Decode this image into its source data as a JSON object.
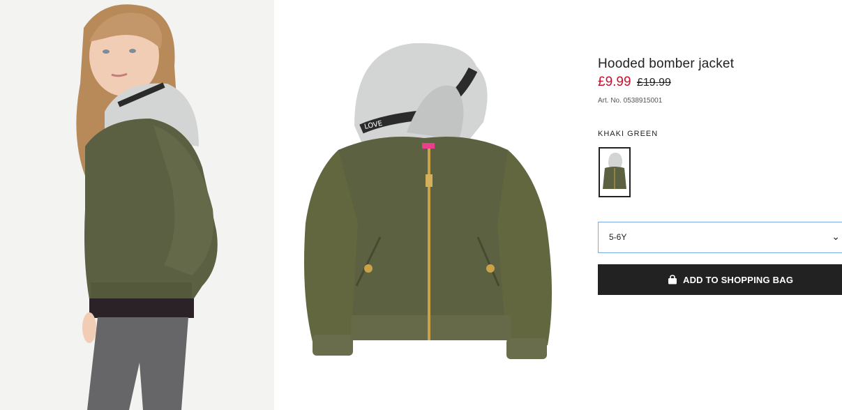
{
  "product": {
    "title": "Hooded bomber jacket",
    "price_sale": "£9.99",
    "price_original": "£19.99",
    "article_number": "Art. No. 0538915001",
    "color_name": "KHAKI GREEN",
    "hood_print": "LOVE"
  },
  "size_selector": {
    "selected": "5-6Y",
    "chevron": "⌄"
  },
  "actions": {
    "add_to_bag_label": "ADD TO SHOPPING BAG",
    "add_to_bag_icon": "shopping-bag-icon"
  },
  "colors": {
    "sale_price": "#c8102e",
    "button_bg": "#222222",
    "select_border": "#7aa7e6",
    "jacket_khaki": "#5c6141",
    "hood_grey": "#d3d4d4"
  }
}
